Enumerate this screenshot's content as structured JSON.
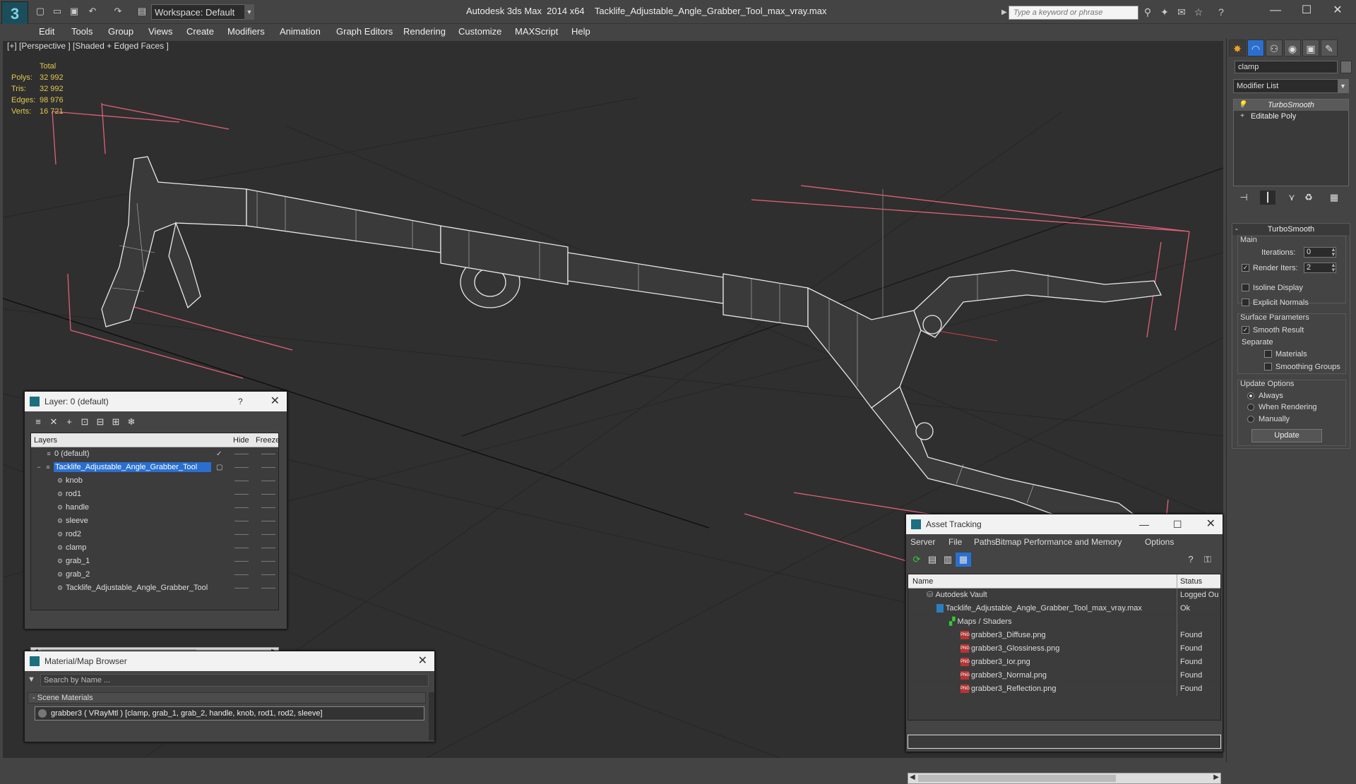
{
  "titlebar": {
    "workspace": "Workspace: Default",
    "app": "Autodesk 3ds Max  2014 x64",
    "file": "Tacklife_Adjustable_Angle_Grabber_Tool_max_vray.max",
    "search_placeholder": "Type a keyword or phrase"
  },
  "menu": [
    "Edit",
    "Tools",
    "Group",
    "Views",
    "Create",
    "Modifiers",
    "Animation",
    "Graph Editors",
    "Rendering",
    "Customize",
    "MAXScript",
    "Help"
  ],
  "viewport": {
    "label": "[+] [Perspective ] [Shaded + Edged Faces ]",
    "stats_header": "Total",
    "stats": [
      {
        "label": "Polys:",
        "value": "32 992"
      },
      {
        "label": "Tris:",
        "value": "32 992"
      },
      {
        "label": "Edges:",
        "value": "98 976"
      },
      {
        "label": "Verts:",
        "value": "16 721"
      }
    ]
  },
  "command_panel": {
    "object_name": "clamp",
    "modifier_list": "Modifier List",
    "stack": [
      "TurboSmooth",
      "Editable Poly"
    ],
    "rollout_title": "TurboSmooth",
    "main_group": "Main",
    "iterations_label": "Iterations:",
    "iterations_value": "0",
    "render_iters_label": "Render Iters:",
    "render_iters_value": "2",
    "isoline": "Isoline Display",
    "explicit_normals": "Explicit Normals",
    "surface_params": "Surface Parameters",
    "smooth_result": "Smooth Result",
    "separate": "Separate",
    "materials": "Materials",
    "smoothing_groups": "Smoothing Groups",
    "update_options": "Update Options",
    "always": "Always",
    "when_rendering": "When Rendering",
    "manually": "Manually",
    "update_btn": "Update"
  },
  "layer_dialog": {
    "title": "Layer: 0 (default)",
    "help": "?",
    "col_layers": "Layers",
    "col_hide": "Hide",
    "col_freeze": "Freeze",
    "rows": [
      {
        "name": "0 (default)"
      },
      {
        "name": "Tacklife_Adjustable_Angle_Grabber_Tool"
      },
      {
        "name": "knob"
      },
      {
        "name": "rod1"
      },
      {
        "name": "handle"
      },
      {
        "name": "sleeve"
      },
      {
        "name": "rod2"
      },
      {
        "name": "clamp"
      },
      {
        "name": "grab_1"
      },
      {
        "name": "grab_2"
      },
      {
        "name": "Tacklife_Adjustable_Angle_Grabber_Tool"
      }
    ]
  },
  "material_browser": {
    "title": "Material/Map Browser",
    "search_placeholder": "Search by Name ...",
    "section": "Scene Materials",
    "item": "grabber3  ( VRayMtl )  [clamp, grab_1, grab_2, handle, knob, rod1, rod2, sleeve]"
  },
  "asset_tracking": {
    "title": "Asset Tracking",
    "menu": [
      "Server",
      "File",
      "Paths",
      "Bitmap Performance and Memory",
      "Options"
    ],
    "col_name": "Name",
    "col_status": "Status",
    "rows": [
      {
        "name": "Autodesk Vault",
        "status": "Logged Ou"
      },
      {
        "name": "Tacklife_Adjustable_Angle_Grabber_Tool_max_vray.max",
        "status": "Ok"
      },
      {
        "name": "Maps / Shaders",
        "status": ""
      },
      {
        "name": "grabber3_Diffuse.png",
        "status": "Found"
      },
      {
        "name": "grabber3_Glossiness.png",
        "status": "Found"
      },
      {
        "name": "grabber3_Ior.png",
        "status": "Found"
      },
      {
        "name": "grabber3_Normal.png",
        "status": "Found"
      },
      {
        "name": "grabber3_Reflection.png",
        "status": "Found"
      }
    ]
  },
  "colors": {
    "selection": "#2a6fd0",
    "accent": "#1b6f7f",
    "wire": "#ffffff",
    "gizmo": "#e0607a"
  }
}
